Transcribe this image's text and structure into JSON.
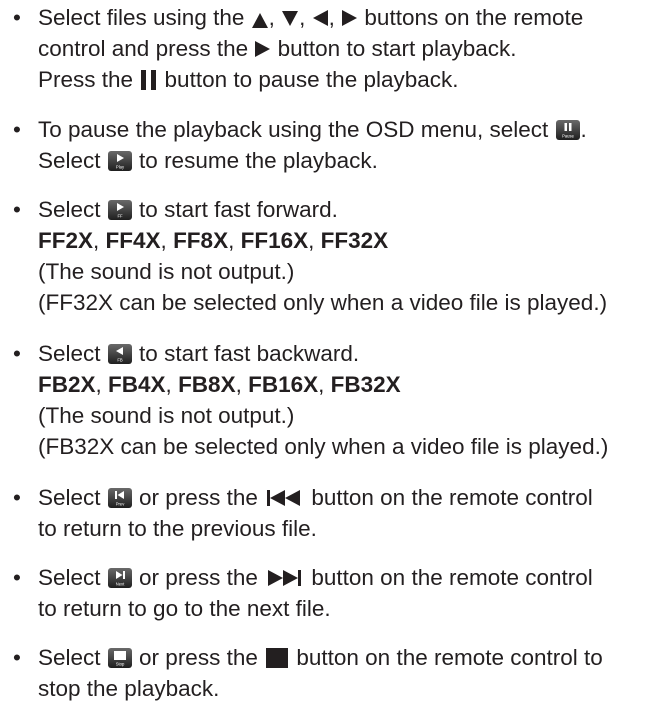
{
  "bullet": "•",
  "items": [
    {
      "lines": [
        [
          "Select files using the ",
          "icon:arrow-up",
          ", ",
          "icon:arrow-down",
          ", ",
          "icon:arrow-left",
          ", ",
          "icon:arrow-right",
          " buttons on the remote"
        ],
        [
          "control and press the ",
          "icon:arrow-right",
          " button to start playback."
        ],
        [
          "Press the ",
          "icon:pause-bars",
          " button to pause the playback."
        ]
      ]
    },
    {
      "lines": [
        [
          "To pause the playback using the OSD menu, select ",
          "icon:osd-pause",
          "."
        ],
        [
          "Select ",
          "icon:osd-play",
          " to resume the playback."
        ]
      ]
    },
    {
      "lines": [
        [
          "Select ",
          "icon:osd-ff",
          " to start fast forward."
        ],
        [
          "bold:FF2X",
          ", ",
          "bold:FF4X",
          ", ",
          "bold:FF8X",
          ", ",
          "bold:FF16X",
          ", ",
          "bold:FF32X"
        ],
        [
          "(The sound is not output.)"
        ],
        [
          "(FF32X can be selected only when a video file is played.)"
        ]
      ]
    },
    {
      "lines": [
        [
          "Select ",
          "icon:osd-fb",
          " to start fast backward."
        ],
        [
          "bold:FB2X",
          ", ",
          "bold:FB4X",
          ", ",
          "bold:FB8X",
          ", ",
          "bold:FB16X",
          ", ",
          "bold:FB32X"
        ],
        [
          "(The sound is not output.)"
        ],
        [
          "(FB32X can be selected only when a video file is played.)"
        ]
      ]
    },
    {
      "lines": [
        [
          "Select ",
          "icon:osd-prev",
          " or press the ",
          "icon:skip-prev",
          " button on the remote control"
        ],
        [
          "to return to the previous file."
        ]
      ]
    },
    {
      "lines": [
        [
          "Select ",
          "icon:osd-next",
          " or press the ",
          "icon:skip-next",
          " button on the remote control"
        ],
        [
          "to return to go to the next file."
        ]
      ]
    },
    {
      "lines": [
        [
          "Select ",
          "icon:osd-stop",
          " or press the ",
          "icon:stop-square",
          " button on the remote control to"
        ],
        [
          "stop the playback."
        ]
      ]
    }
  ],
  "osd_icons": {
    "osd-pause": {
      "caption": "Pause",
      "symbol": "pause"
    },
    "osd-play": {
      "caption": "Play",
      "symbol": "play"
    },
    "osd-ff": {
      "caption": "FF",
      "symbol": "play"
    },
    "osd-fb": {
      "caption": "FB",
      "symbol": "back"
    },
    "osd-prev": {
      "caption": "Prev",
      "symbol": "prev"
    },
    "osd-next": {
      "caption": "Next",
      "symbol": "next"
    },
    "osd-stop": {
      "caption": "Stop",
      "symbol": "stop"
    }
  },
  "colors": {
    "text": "#231f20",
    "tile_top": "#6a6a6a",
    "tile_bottom": "#1e1e1e",
    "tile_glyph": "#ffffff"
  }
}
